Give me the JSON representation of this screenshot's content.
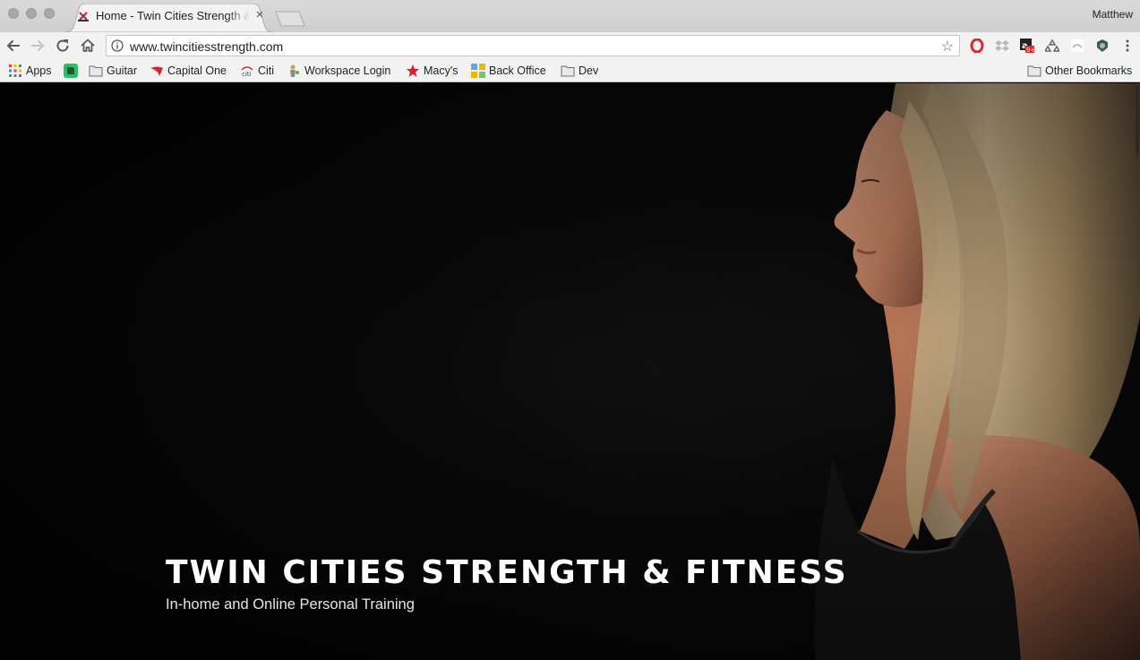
{
  "browser": {
    "tab": {
      "title": "Home - Twin Cities Strength & Fitness",
      "close_symbol": "×"
    },
    "profile_name": "Matthew",
    "address_bar": {
      "url": "www.twincitiesstrength.com"
    },
    "icons": {
      "back": "arrow-left-icon",
      "forward": "arrow-right-icon",
      "reload": "reload-icon",
      "home": "home-icon",
      "info": "info-icon",
      "bookmark_star": "star-icon",
      "menu": "kebab-menu-icon"
    }
  },
  "bookmarks": {
    "items": [
      {
        "label": "Apps",
        "icon": "apps-grid-icon"
      },
      {
        "label": "",
        "icon": "evernote-icon"
      },
      {
        "label": "Guitar",
        "icon": "folder-icon"
      },
      {
        "label": "Capital One",
        "icon": "capital-one-icon"
      },
      {
        "label": "Citi",
        "icon": "citi-icon"
      },
      {
        "label": "Workspace Login",
        "icon": "workspace-icon"
      },
      {
        "label": "Macy's",
        "icon": "macys-star-icon"
      },
      {
        "label": "Back Office",
        "icon": "back-office-icon"
      },
      {
        "label": "Dev",
        "icon": "folder-icon"
      }
    ],
    "other": {
      "label": "Other Bookmarks",
      "icon": "folder-icon"
    }
  },
  "hero": {
    "title": "TWIN CITIES STRENGTH & FITNESS",
    "subtitle": "In-home and Online Personal Training"
  },
  "colors": {
    "chrome_bg": "#f2f2f2",
    "tabstrip_bg": "#d4d4d4",
    "page_bg": "#080808",
    "hero_text": "#ffffff",
    "macys_red": "#e11a2b",
    "opera_red": "#e0262d"
  }
}
